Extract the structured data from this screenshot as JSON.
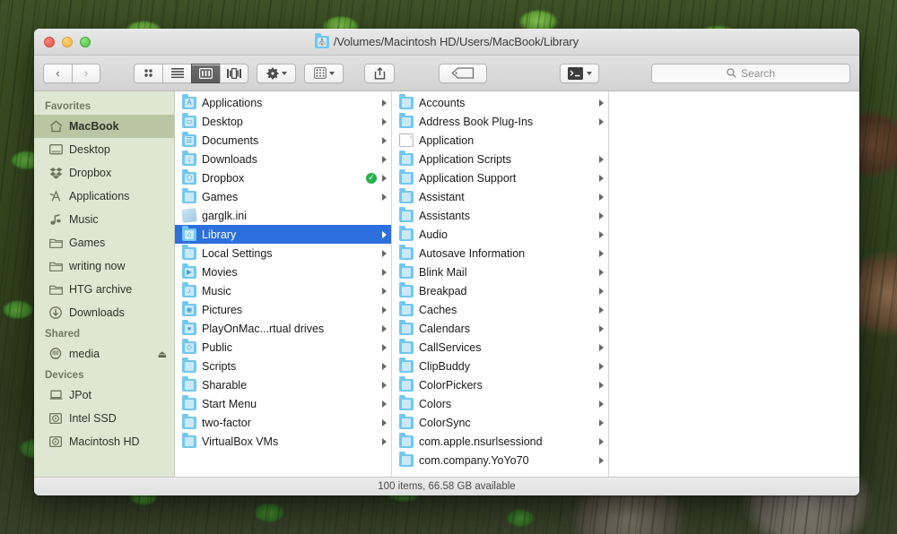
{
  "window": {
    "title": "/Volumes/Macintosh HD/Users/MacBook/Library",
    "title_icon": "folder-icon",
    "close_label": "close-button",
    "minimize_label": "minimize-button",
    "zoom_label": "zoom-button"
  },
  "toolbar": {
    "back_label": "‹",
    "forward_label": "›",
    "view_modes": [
      {
        "name": "icon-view",
        "active": false
      },
      {
        "name": "list-view",
        "active": false
      },
      {
        "name": "column-view",
        "active": true
      },
      {
        "name": "coverflow-view",
        "active": false
      }
    ],
    "action_menu": "gear-icon",
    "arrange_menu": "arrange-icon",
    "share_button": "share-icon",
    "tag_button": "tag-icon",
    "terminal_menu": "terminal-icon"
  },
  "search": {
    "placeholder": "Search",
    "value": "",
    "icon": "search-icon"
  },
  "sidebar": {
    "sections": [
      {
        "header": "Favorites",
        "items": [
          {
            "label": "MacBook",
            "icon": "home-icon",
            "selected": true,
            "eject": false
          },
          {
            "label": "Desktop",
            "icon": "desktop-icon",
            "selected": false,
            "eject": false
          },
          {
            "label": "Dropbox",
            "icon": "dropbox-icon",
            "selected": false,
            "eject": false
          },
          {
            "label": "Applications",
            "icon": "applications-icon",
            "selected": false,
            "eject": false
          },
          {
            "label": "Music",
            "icon": "music-note-icon",
            "selected": false,
            "eject": false
          },
          {
            "label": "Games",
            "icon": "folder-icon",
            "selected": false,
            "eject": false
          },
          {
            "label": "writing now",
            "icon": "folder-icon",
            "selected": false,
            "eject": false
          },
          {
            "label": "HTG archive",
            "icon": "folder-icon",
            "selected": false,
            "eject": false
          },
          {
            "label": "Downloads",
            "icon": "downloads-icon",
            "selected": false,
            "eject": false
          }
        ]
      },
      {
        "header": "Shared",
        "items": [
          {
            "label": "media",
            "icon": "display-icon",
            "selected": false,
            "eject": true
          }
        ]
      },
      {
        "header": "Devices",
        "items": [
          {
            "label": "JPot",
            "icon": "laptop-icon",
            "selected": false,
            "eject": false
          },
          {
            "label": "Intel SSD",
            "icon": "drive-icon",
            "selected": false,
            "eject": false
          },
          {
            "label": "Macintosh HD",
            "icon": "drive-icon",
            "selected": false,
            "eject": false
          }
        ]
      }
    ]
  },
  "columns": [
    {
      "name": "column-macbook",
      "rows": [
        {
          "label": "Applications",
          "icon": "folder-icon",
          "glyph": "A",
          "arrow": true,
          "selected": false,
          "badge": ""
        },
        {
          "label": "Desktop",
          "icon": "folder-icon",
          "glyph": "▭",
          "arrow": true,
          "selected": false,
          "badge": ""
        },
        {
          "label": "Documents",
          "icon": "folder-icon",
          "glyph": "☰",
          "arrow": true,
          "selected": false,
          "badge": ""
        },
        {
          "label": "Downloads",
          "icon": "folder-icon",
          "glyph": "↓",
          "arrow": true,
          "selected": false,
          "badge": ""
        },
        {
          "label": "Dropbox",
          "icon": "folder-icon",
          "glyph": "⬡",
          "arrow": true,
          "selected": false,
          "badge": "✓"
        },
        {
          "label": "Games",
          "icon": "folder-icon",
          "glyph": "",
          "arrow": true,
          "selected": false,
          "badge": ""
        },
        {
          "label": "garglk.ini",
          "icon": "ini-file-icon",
          "glyph": "",
          "arrow": false,
          "selected": false,
          "badge": ""
        },
        {
          "label": "Library",
          "icon": "folder-icon",
          "glyph": "⌂",
          "arrow": true,
          "selected": true,
          "badge": ""
        },
        {
          "label": "Local Settings",
          "icon": "folder-icon",
          "glyph": "",
          "arrow": true,
          "selected": false,
          "badge": ""
        },
        {
          "label": "Movies",
          "icon": "folder-icon",
          "glyph": "▶",
          "arrow": true,
          "selected": false,
          "badge": ""
        },
        {
          "label": "Music",
          "icon": "folder-icon",
          "glyph": "♪",
          "arrow": true,
          "selected": false,
          "badge": ""
        },
        {
          "label": "Pictures",
          "icon": "folder-icon",
          "glyph": "◉",
          "arrow": true,
          "selected": false,
          "badge": ""
        },
        {
          "label": "PlayOnMac...rtual drives",
          "icon": "folder-icon",
          "glyph": "●",
          "arrow": true,
          "selected": false,
          "badge": ""
        },
        {
          "label": "Public",
          "icon": "folder-icon",
          "glyph": "◇",
          "arrow": true,
          "selected": false,
          "badge": ""
        },
        {
          "label": "Scripts",
          "icon": "folder-icon",
          "glyph": "",
          "arrow": true,
          "selected": false,
          "badge": ""
        },
        {
          "label": "Sharable",
          "icon": "folder-icon",
          "glyph": "",
          "arrow": true,
          "selected": false,
          "badge": ""
        },
        {
          "label": "Start Menu",
          "icon": "folder-icon",
          "glyph": "",
          "arrow": true,
          "selected": false,
          "badge": ""
        },
        {
          "label": "two-factor",
          "icon": "folder-icon",
          "glyph": "",
          "arrow": true,
          "selected": false,
          "badge": ""
        },
        {
          "label": "VirtualBox VMs",
          "icon": "folder-icon",
          "glyph": "",
          "arrow": true,
          "selected": false,
          "badge": ""
        }
      ]
    },
    {
      "name": "column-library",
      "rows": [
        {
          "label": "Accounts",
          "icon": "folder-icon",
          "glyph": "",
          "arrow": true,
          "selected": false,
          "badge": ""
        },
        {
          "label": "Address Book Plug-Ins",
          "icon": "folder-icon",
          "glyph": "",
          "arrow": true,
          "selected": false,
          "badge": ""
        },
        {
          "label": "Application",
          "icon": "document-file-icon",
          "glyph": "",
          "arrow": false,
          "selected": false,
          "badge": ""
        },
        {
          "label": "Application Scripts",
          "icon": "folder-icon",
          "glyph": "",
          "arrow": true,
          "selected": false,
          "badge": ""
        },
        {
          "label": "Application Support",
          "icon": "folder-icon",
          "glyph": "",
          "arrow": true,
          "selected": false,
          "badge": ""
        },
        {
          "label": "Assistant",
          "icon": "folder-icon",
          "glyph": "",
          "arrow": true,
          "selected": false,
          "badge": ""
        },
        {
          "label": "Assistants",
          "icon": "folder-icon",
          "glyph": "",
          "arrow": true,
          "selected": false,
          "badge": ""
        },
        {
          "label": "Audio",
          "icon": "folder-icon",
          "glyph": "",
          "arrow": true,
          "selected": false,
          "badge": ""
        },
        {
          "label": "Autosave Information",
          "icon": "folder-icon",
          "glyph": "",
          "arrow": true,
          "selected": false,
          "badge": ""
        },
        {
          "label": "Blink Mail",
          "icon": "folder-icon",
          "glyph": "",
          "arrow": true,
          "selected": false,
          "badge": ""
        },
        {
          "label": "Breakpad",
          "icon": "folder-icon",
          "glyph": "",
          "arrow": true,
          "selected": false,
          "badge": ""
        },
        {
          "label": "Caches",
          "icon": "folder-icon",
          "glyph": "",
          "arrow": true,
          "selected": false,
          "badge": ""
        },
        {
          "label": "Calendars",
          "icon": "folder-icon",
          "glyph": "",
          "arrow": true,
          "selected": false,
          "badge": ""
        },
        {
          "label": "CallServices",
          "icon": "folder-icon",
          "glyph": "",
          "arrow": true,
          "selected": false,
          "badge": ""
        },
        {
          "label": "ClipBuddy",
          "icon": "folder-icon",
          "glyph": "",
          "arrow": true,
          "selected": false,
          "badge": ""
        },
        {
          "label": "ColorPickers",
          "icon": "folder-icon",
          "glyph": "",
          "arrow": true,
          "selected": false,
          "badge": ""
        },
        {
          "label": "Colors",
          "icon": "folder-icon",
          "glyph": "",
          "arrow": true,
          "selected": false,
          "badge": ""
        },
        {
          "label": "ColorSync",
          "icon": "folder-icon",
          "glyph": "",
          "arrow": true,
          "selected": false,
          "badge": ""
        },
        {
          "label": "com.apple.nsurlsessiond",
          "icon": "folder-icon",
          "glyph": "",
          "arrow": true,
          "selected": false,
          "badge": ""
        },
        {
          "label": "com.company.YoYo70",
          "icon": "folder-icon",
          "glyph": "",
          "arrow": true,
          "selected": false,
          "badge": ""
        }
      ]
    }
  ],
  "statusbar": {
    "text": "100 items, 66.58 GB available"
  },
  "colors": {
    "selection_blue": "#2c6fdd",
    "sidebar_bg": "#dfe7d3",
    "sidebar_selected": "#b9c6a4",
    "folder_blue": "#72c7ef",
    "dropbox_check_green": "#23b14b"
  }
}
